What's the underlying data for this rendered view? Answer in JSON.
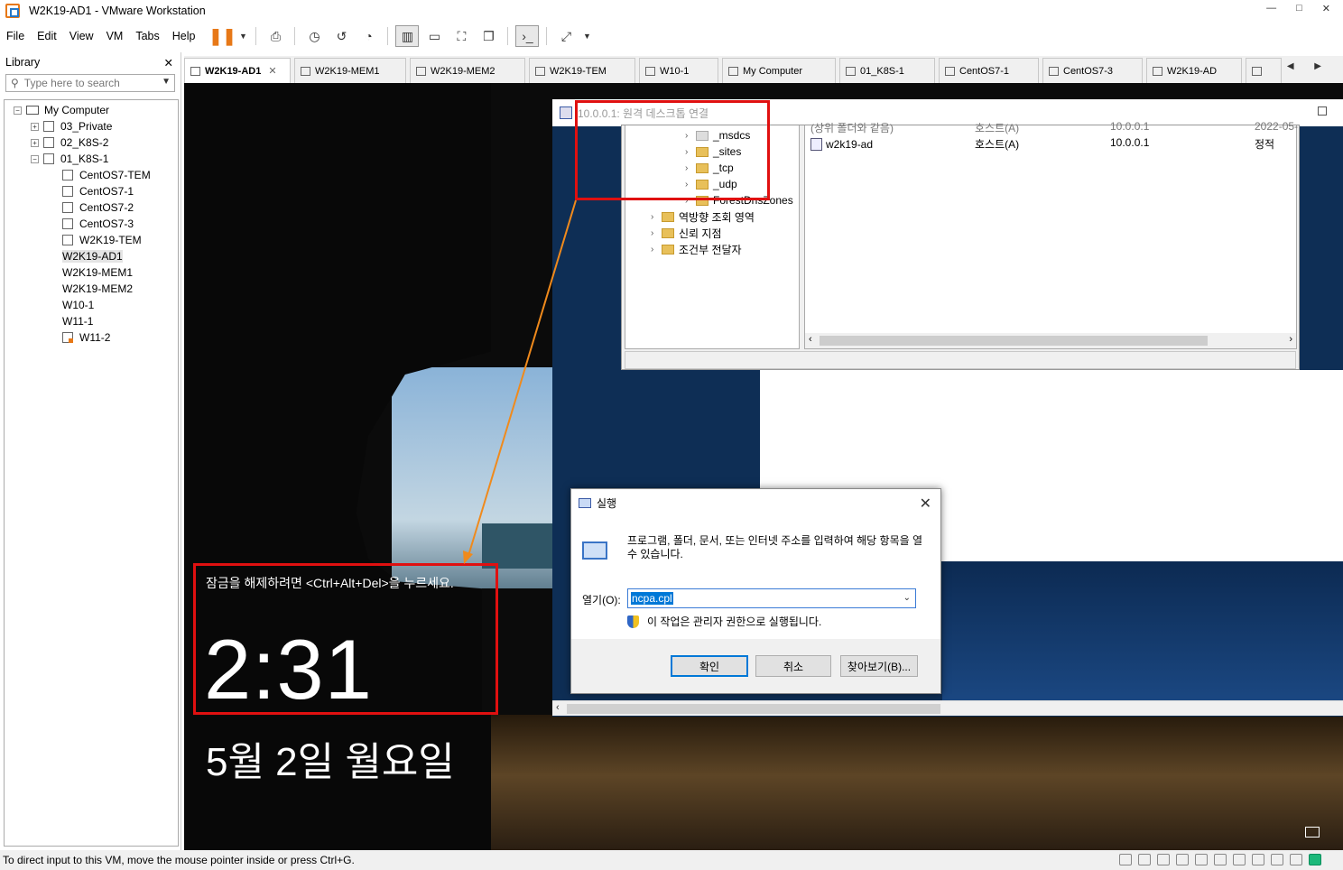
{
  "window": {
    "title": "W2K19-AD1 - VMware Workstation",
    "minimize": "—",
    "restore": "□",
    "close": "✕"
  },
  "menu": [
    "File",
    "Edit",
    "View",
    "VM",
    "Tabs",
    "Help"
  ],
  "library": {
    "title": "Library",
    "close": "✕",
    "search_placeholder": "Type here to search",
    "tree": {
      "root": "My Computer",
      "groups": [
        {
          "name": "03_Private",
          "toggle": "+"
        },
        {
          "name": "02_K8S-2",
          "toggle": "+"
        },
        {
          "name": "01_K8S-1",
          "toggle": "−"
        }
      ],
      "vms": [
        {
          "name": "CentOS7-TEM",
          "state": "off"
        },
        {
          "name": "CentOS7-1",
          "state": "off"
        },
        {
          "name": "CentOS7-2",
          "state": "off"
        },
        {
          "name": "CentOS7-3",
          "state": "off"
        },
        {
          "name": "W2K19-TEM",
          "state": "off"
        },
        {
          "name": "W2K19-AD1",
          "state": "running"
        },
        {
          "name": "W2K19-MEM1",
          "state": "running"
        },
        {
          "name": "W2K19-MEM2",
          "state": "running"
        },
        {
          "name": "W10-1",
          "state": "running"
        },
        {
          "name": "W11-1",
          "state": "running"
        },
        {
          "name": "W11-2",
          "state": "suspended"
        }
      ]
    }
  },
  "tabs": [
    "W2K19-AD1",
    "W2K19-MEM1",
    "W2K19-MEM2",
    "W2K19-TEM",
    "W10-1",
    "My Computer",
    "01_K8S-1",
    "CentOS7-1",
    "CentOS7-3",
    "W2K19-AD",
    ""
  ],
  "tab_close": "✕",
  "tab_nav": "◀ ▶",
  "rdp": {
    "title": "10.0.0.1: 원격 데스크톱 연결"
  },
  "dns": {
    "tree": [
      "_msdcs",
      "_sites",
      "_tcp",
      "_udp",
      "ForestDnsZones",
      "역방향 조회 영역",
      "신뢰 지점",
      "조건부 전달자"
    ],
    "rows": [
      {
        "name": "(상위 폴더와 같음)",
        "type": "호스트(A)",
        "data": "10.0.0.1",
        "stamp": "2022-05-"
      },
      {
        "name": "w2k19-ad",
        "type": "호스트(A)",
        "data": "10.0.0.1",
        "stamp": "정적"
      }
    ]
  },
  "run_dialog": {
    "title": "실행",
    "close": "✕",
    "description": "프로그램, 폴더, 문서, 또는 인터넷 주소를 입력하여 해당 항목을 열 수 있습니다.",
    "open_label": "열기(O):",
    "input_value": "ncpa.cpl",
    "admin_note": "이 작업은 관리자 권한으로 실행됩니다.",
    "ok": "확인",
    "cancel": "취소",
    "browse": "찾아보기(B)..."
  },
  "lockscreen": {
    "message": "잠금을 해제하려면 <Ctrl+Alt+Del>을 누르세요.",
    "time": "2:31",
    "date": "5월 2일 월요일"
  },
  "annotation_color": "#e01010",
  "arrow_color": "#f08a1c",
  "status_text": "To direct input to this VM, move the mouse pointer inside or press Ctrl+G."
}
